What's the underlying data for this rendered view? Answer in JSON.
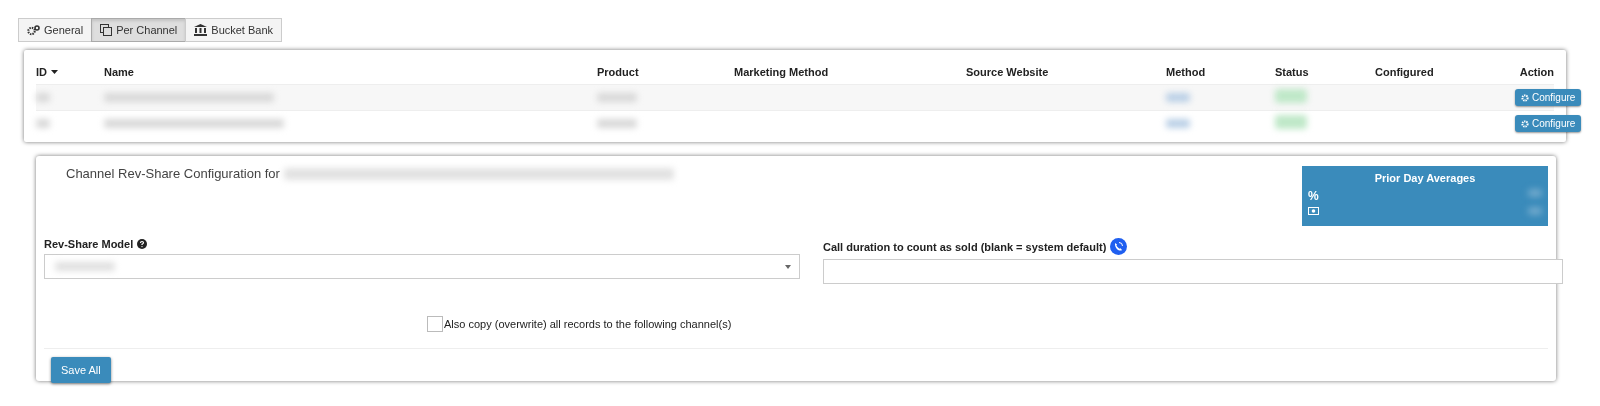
{
  "tabs": [
    {
      "label": "General",
      "selected": false
    },
    {
      "label": "Per Channel",
      "selected": true
    },
    {
      "label": "Bucket Bank",
      "selected": false
    }
  ],
  "table": {
    "columns": [
      {
        "label": "ID",
        "sorted": true
      },
      {
        "label": "Name",
        "sorted": false
      },
      {
        "label": "Product",
        "sorted": false
      },
      {
        "label": "Marketing Method",
        "sorted": false
      },
      {
        "label": "Source Website",
        "sorted": false
      },
      {
        "label": "Method",
        "sorted": false
      },
      {
        "label": "Status",
        "sorted": false
      },
      {
        "label": "Configured",
        "sorted": false
      },
      {
        "label": "Action",
        "sorted": false
      }
    ],
    "rows": [
      {
        "action": "Configure"
      },
      {
        "action": "Configure"
      }
    ]
  },
  "config": {
    "title": "Channel Rev-Share Configuration for",
    "averages": {
      "title": "Prior Day Averages",
      "percent_symbol": "%"
    },
    "rev_share_label": "Rev-Share Model",
    "call_duration_label": "Call duration to count as sold (blank = system default)",
    "copy_checkbox": {
      "label": "Also copy (overwrite) all records to the following channel(s)",
      "checked": false
    },
    "save_button": "Save All"
  }
}
